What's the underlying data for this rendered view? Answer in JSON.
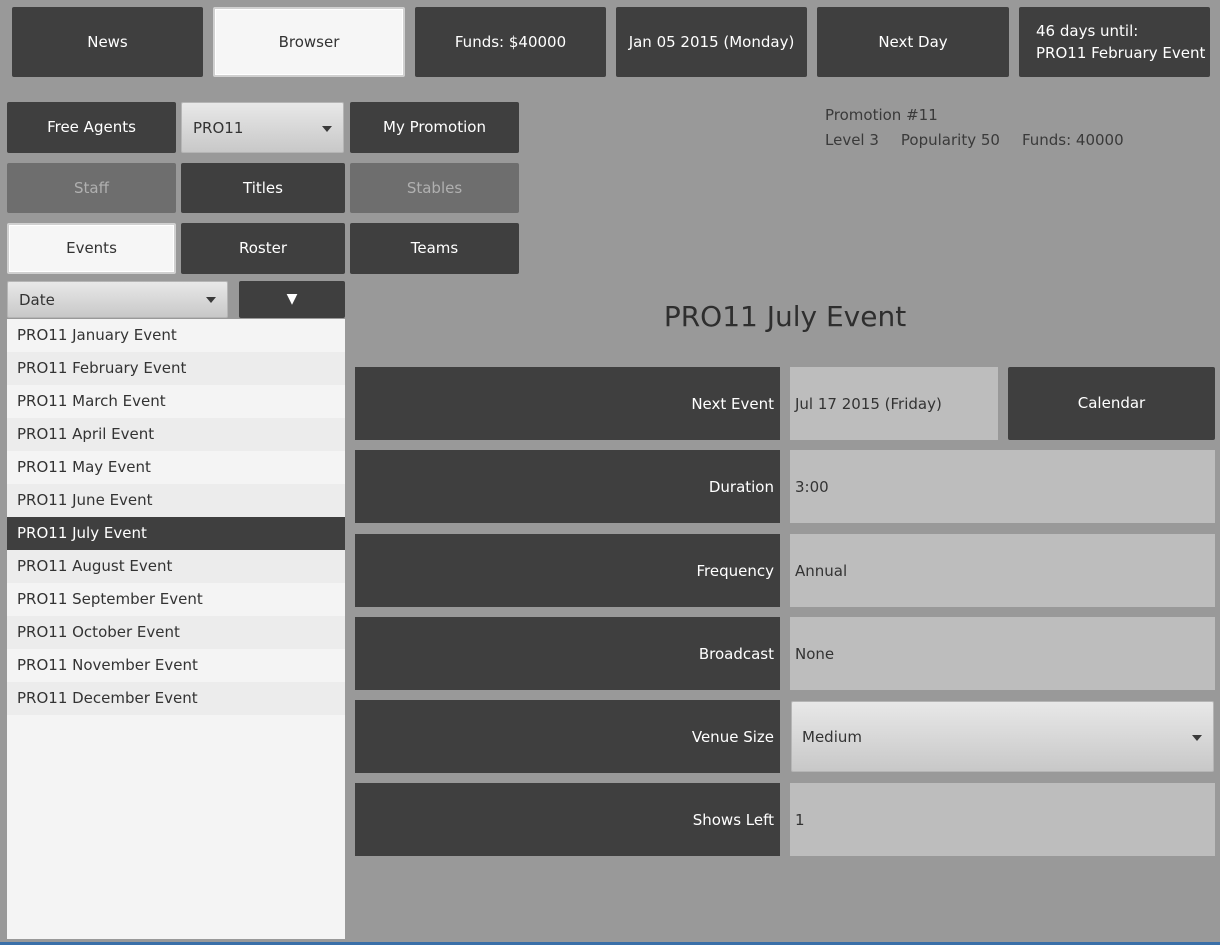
{
  "topbar": {
    "news": "News",
    "browser": "Browser",
    "funds": "Funds: $40000",
    "date": "Jan 05 2015 (Monday)",
    "next_day": "Next Day",
    "deadline_line1": "46 days until:",
    "deadline_line2": "PRO11 February Event"
  },
  "nav": {
    "free_agents": "Free Agents",
    "promotion_select": "PRO11",
    "my_promotion": "My Promotion",
    "staff": "Staff",
    "titles": "Titles",
    "stables": "Stables",
    "events": "Events",
    "roster": "Roster",
    "teams": "Teams"
  },
  "promotion_info": {
    "name": "Promotion #11",
    "level": "Level 3",
    "popularity": "Popularity 50",
    "funds": "Funds: 40000"
  },
  "sort": {
    "field": "Date",
    "direction_icon": "▼"
  },
  "events_list": [
    "PRO11 January Event",
    "PRO11 February Event",
    "PRO11 March Event",
    "PRO11 April Event",
    "PRO11 May Event",
    "PRO11 June Event",
    "PRO11 July Event",
    "PRO11 August Event",
    "PRO11 September Event",
    "PRO11 October Event",
    "PRO11 November Event",
    "PRO11 December Event"
  ],
  "selected_event": "PRO11 July Event",
  "details": {
    "title": "PRO11 July Event",
    "next_event_label": "Next Event",
    "next_event_value": "Jul 17 2015 (Friday)",
    "calendar_button": "Calendar",
    "duration_label": "Duration",
    "duration_value": "3:00",
    "frequency_label": "Frequency",
    "frequency_value": "Annual",
    "broadcast_label": "Broadcast",
    "broadcast_value": "None",
    "venue_size_label": "Venue Size",
    "venue_size_value": "Medium",
    "shows_left_label": "Shows Left",
    "shows_left_value": "1"
  }
}
